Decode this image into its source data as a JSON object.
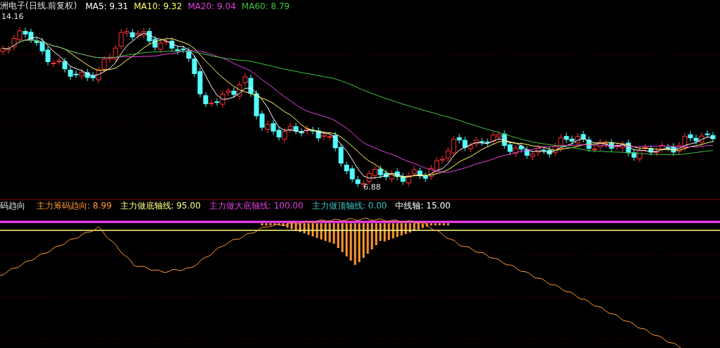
{
  "header": {
    "title": "洲电子(日线.前复权)",
    "indicators": [
      {
        "label": "MA5: 9.31",
        "color": "#ffffff"
      },
      {
        "label": "MA10: 9.32",
        "color": "#ffff66"
      },
      {
        "label": "MA20: 9.04",
        "color": "#e040e0"
      },
      {
        "label": "MA60: 8.79",
        "color": "#40c040"
      }
    ]
  },
  "price_chart": {
    "high_label": "14.16",
    "low_label": "6.88"
  },
  "indicator": {
    "name": "码趋向",
    "readings": [
      {
        "label": "主力筹码趋向: 8.99",
        "color": "#ff9933"
      },
      {
        "label": "主力做底轴线: 95.00",
        "color": "#ffff80"
      },
      {
        "label": "主力做大底轴线: 100.00",
        "color": "#e040e0"
      },
      {
        "label": "主力做顶轴线: 0.00",
        "color": "#40c0c0"
      },
      {
        "label": "中线轴: 15.00",
        "color": "#ffffff"
      }
    ]
  }
}
